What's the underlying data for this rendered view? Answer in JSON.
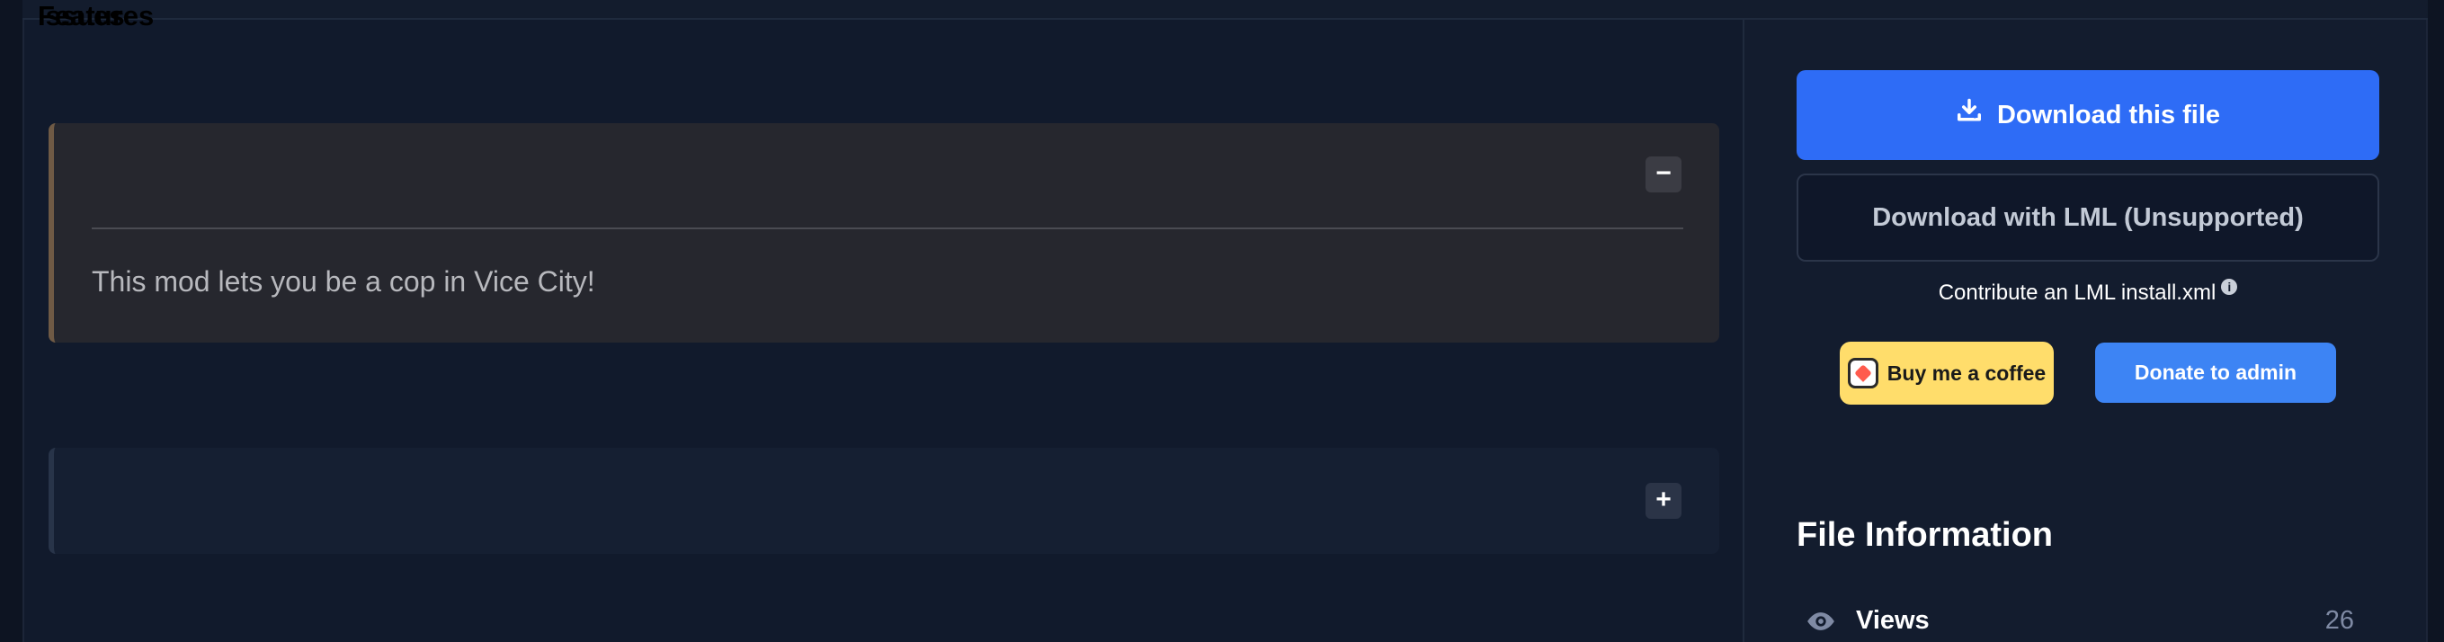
{
  "features_panel": {
    "title": "Features",
    "toggle_symbol": "−",
    "body": "This mod lets you be a cop in Vice City!"
  },
  "issues_panel": {
    "title": "Issues",
    "toggle_symbol": "+"
  },
  "sidebar": {
    "download_button": {
      "label": "Download this file",
      "icon": "download-icon"
    },
    "lml_button": {
      "label": "Download with LML (Unsupported)"
    },
    "contribute_text": "Contribute an LML install.xml",
    "info_icon_glyph": "i",
    "coffee_button": {
      "label": "Buy me a coffee",
      "icon": "ko-fi-cup-icon"
    },
    "donate_button": {
      "label": "Donate to admin"
    },
    "file_information": {
      "title": "File Information",
      "views": {
        "label": "Views",
        "value": "26",
        "icon": "eye-icon"
      }
    }
  },
  "colors": {
    "page_bg": "#111a2c",
    "features_bg": "#26272e",
    "features_accent": "#6f5a45",
    "download_blue": "#2e6cf6",
    "donate_blue": "#3d84f4",
    "coffee_yellow": "#ffdd6b"
  }
}
